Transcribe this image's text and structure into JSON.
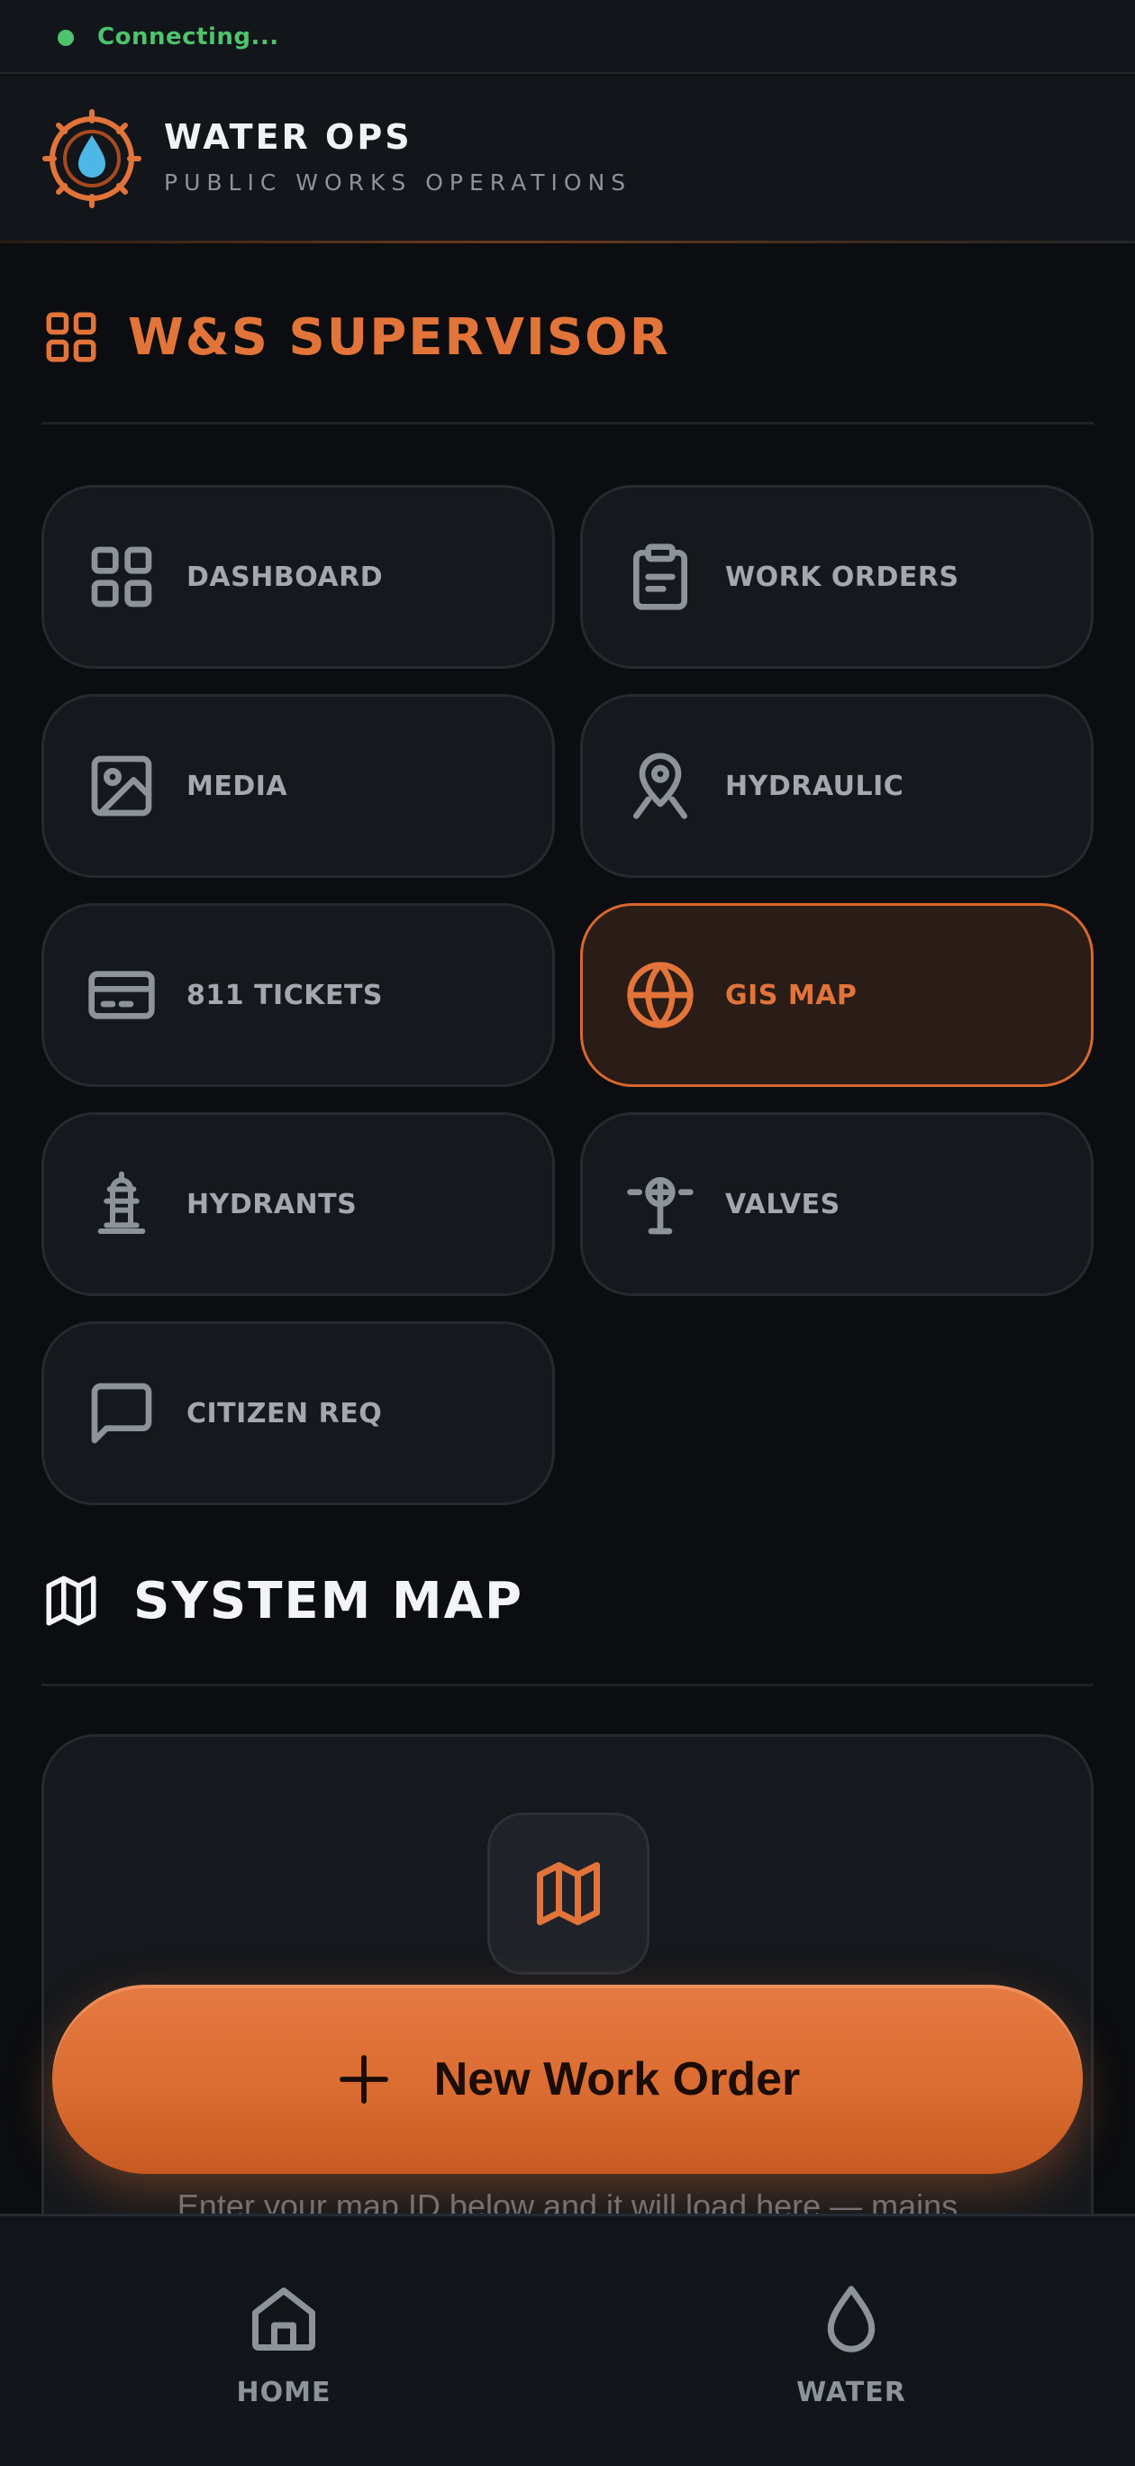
{
  "status": {
    "text": "Connecting...",
    "color": "#4ec36d"
  },
  "header": {
    "title": "WATER OPS",
    "subtitle": "PUBLIC WORKS OPERATIONS",
    "logo_icon": "water-drop-gear-icon"
  },
  "role": {
    "title": "W&S SUPERVISOR",
    "icon": "grid-icon"
  },
  "tiles": [
    {
      "label": "DASHBOARD",
      "icon": "grid-icon",
      "active": false
    },
    {
      "label": "WORK ORDERS",
      "icon": "clipboard-icon",
      "active": false
    },
    {
      "label": "MEDIA",
      "icon": "image-icon",
      "active": false
    },
    {
      "label": "HYDRAULIC",
      "icon": "map-pin-icon",
      "active": false
    },
    {
      "label": "811 TICKETS",
      "icon": "ticket-card-icon",
      "active": false
    },
    {
      "label": "GIS MAP",
      "icon": "globe-icon",
      "active": true
    },
    {
      "label": "HYDRANTS",
      "icon": "hydrant-icon",
      "active": false
    },
    {
      "label": "VALVES",
      "icon": "valve-icon",
      "active": false
    },
    {
      "label": "CITIZEN REQ",
      "icon": "chat-bubble-icon",
      "active": false
    }
  ],
  "system_map": {
    "title": "SYSTEM MAP",
    "icon": "map-icon",
    "hint": "Enter your map ID below and it will load here — mains"
  },
  "fab": {
    "label": "New Work Order",
    "icon": "plus-icon"
  },
  "bottom_nav": [
    {
      "label": "HOME",
      "icon": "home-icon"
    },
    {
      "label": "WATER",
      "icon": "water-drop-icon"
    }
  ],
  "colors": {
    "accent": "#e2743a",
    "background": "#0b0d10",
    "card": "#15181c",
    "water": "#4fb7e6"
  }
}
